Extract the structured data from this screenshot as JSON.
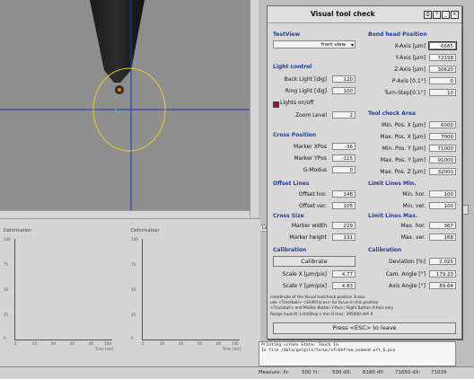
{
  "dialog": {
    "title": "Visual tool check",
    "left": {
      "testview": {
        "header": "TestView",
        "value": "front view"
      },
      "light": {
        "header": "Light control",
        "back_label": "Back Light [dig]",
        "back_value": "120",
        "ring_label": "Ring Light [dig]",
        "ring_value": "100",
        "lights_label": "Lights on/off",
        "zoom_label": "Zoom Level",
        "zoom_value": "2"
      },
      "cross": {
        "header": "Cross Position",
        "mx_label": "Marker XPos",
        "mx_value": "-36",
        "my_label": "Marker YPos",
        "my_value": "-115",
        "gm_label": "G-Modus",
        "gm_value": "0"
      },
      "offset": {
        "header": "Offset Lines",
        "hor_label": "Offset hor.",
        "hor_value": "148",
        "ver_label": "Offset ver.",
        "ver_value": "105"
      },
      "cross_size": {
        "header": "Cross Size",
        "w_label": "Marker width",
        "w_value": "229",
        "h_label": "Marker height",
        "h_value": "131"
      },
      "calibration": {
        "header": "Calibration",
        "button": "Calibrate",
        "sx_label": "Scale X [µm/pix]",
        "sx_value": "4.77",
        "sy_label": "Scale Y [µm/pix]",
        "sy_value": "4.83"
      }
    },
    "right": {
      "bond": {
        "header": "Bond head Position",
        "x_label": "X-Axis [µm]",
        "x_value": "6685",
        "y_label": "Y-Axis [µm]",
        "y_value": "72158",
        "z_label": "Z-Axis [µm]",
        "z_value": "30620",
        "p_label": "P-Axis [0.1°]",
        "p_value": "0",
        "t_label": "Turn-Step[0.1°]",
        "t_value": "10"
      },
      "area": {
        "header": "Tool check Area",
        "minx_label": "Min. Pos. X [µm]",
        "minx_value": "6000",
        "maxx_label": "Max. Pos. X [µm]",
        "maxx_value": "7000",
        "miny_label": "Min. Pos. Y [µm]",
        "miny_value": "71000",
        "maxy_label": "Max. Pos. Y [µm]",
        "maxy_value": "91000",
        "maxz_label": "Max. Pos. Z [µm]",
        "maxz_value": "32000"
      },
      "limit_min": {
        "header": "Limit Lines Min.",
        "hor_label": "Min. hor.",
        "hor_value": "100",
        "ver_label": "Min. ver.",
        "ver_value": "100"
      },
      "limit_max": {
        "header": "Limit Lines Max.",
        "hor_label": "Max. hor.",
        "hor_value": "367",
        "ver_label": "Max. ver.",
        "ver_value": "168"
      },
      "calibration": {
        "header": "Calibration",
        "dev_label": "Deviation [%]",
        "dev_value": "2.025",
        "cam_label": "Cam. Angle [°]",
        "cam_value": "179.23",
        "axis_label": "Axis Angle [°]",
        "axis_value": "89.64"
      }
    },
    "help_lines": [
      "coordinate of the Visual toolcheck position X-axis",
      "use <Trackball> <Shift/Focus> for focus-in this position",
      "<Trackball> and Middle Button Y-Axis / Right Button X-Axis only",
      "Range inµm/X: LimitStop x min 0  max: 295000  def: 0"
    ],
    "esc_button": "Press <ESC> to leave"
  },
  "graphs": [
    {
      "title": "Deformation",
      "yticks": [
        "100",
        "75",
        "50",
        "25",
        "0"
      ],
      "xticks": [
        "0",
        "20",
        "40",
        "60",
        "80",
        "100"
      ],
      "xunit": "Time [ms]"
    },
    {
      "title": "Deformation",
      "yticks": [
        "100",
        "75",
        "50",
        "25",
        "0"
      ],
      "xticks": [
        "0",
        "20",
        "40",
        "60",
        "80",
        "100"
      ],
      "xunit": "Time [ms]"
    }
  ],
  "console_lines": [
    "Printing screen State: Touch In",
    "In file /data/gelgilc/txruc/vfcbkfrom_osmend-prt_6.pcx"
  ],
  "status": {
    "label": "Measure: Xr:",
    "yr": "500 Yr:",
    "dx": "500 dX:",
    "dy": "6185 dY:",
    "ddx": "71650 dX:",
    "ddy": "71029",
    "last": "71029"
  },
  "tab": "La",
  "side_button": "ok"
}
